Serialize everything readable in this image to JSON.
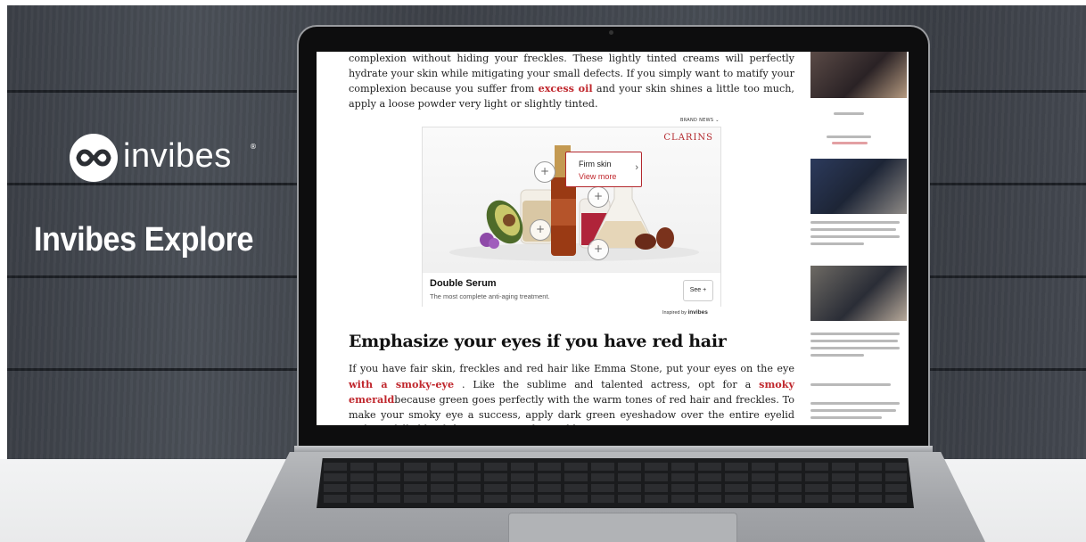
{
  "brand": {
    "name": "invibes",
    "registered": "®",
    "product": "Invibes Explore"
  },
  "article": {
    "paragraph1": {
      "t1": "complexion without hiding your freckles. These lightly tinted creams will perfectly hydrate your skin while mitigating your small defects. If you simply want to matify your complexion because you suffer from ",
      "link": "excess oil",
      "t2": " and your skin shines a little too much, apply a loose powder very light or slightly tinted."
    },
    "brand_news": "BRAND NEWS ⌄",
    "heading": "Emphasize your eyes if you have red hair",
    "paragraph2": {
      "t1": "If you have fair skin, freckles and red hair like Emma Stone, put your eyes on the eye ",
      "link1": "with a smoky-eye",
      "t2": " . Like the sublime and talented actress, opt for a ",
      "link2": "smoky emerald",
      "t3": "because green goes perfectly with the warm tones of red hair and freckles. To make your smoky eye a success, apply dark green eyeshadow over the entire eyelid and carefully blend the contours with a stubby"
    }
  },
  "ad": {
    "brand": "CLARINS",
    "tooltip_title": "Firm skin",
    "tooltip_link": "View more",
    "tooltip_chevron": "›",
    "hotspot": "+",
    "title": "Double Serum",
    "subtitle": "The most complete anti-aging treatment.",
    "see_button": "See +",
    "inspired_prefix": "Inspired by",
    "inspired_brand": "invibes"
  },
  "colors": {
    "link_red": "#c0272d",
    "clarins_red": "#b3282d",
    "wood": "#3f434a"
  }
}
